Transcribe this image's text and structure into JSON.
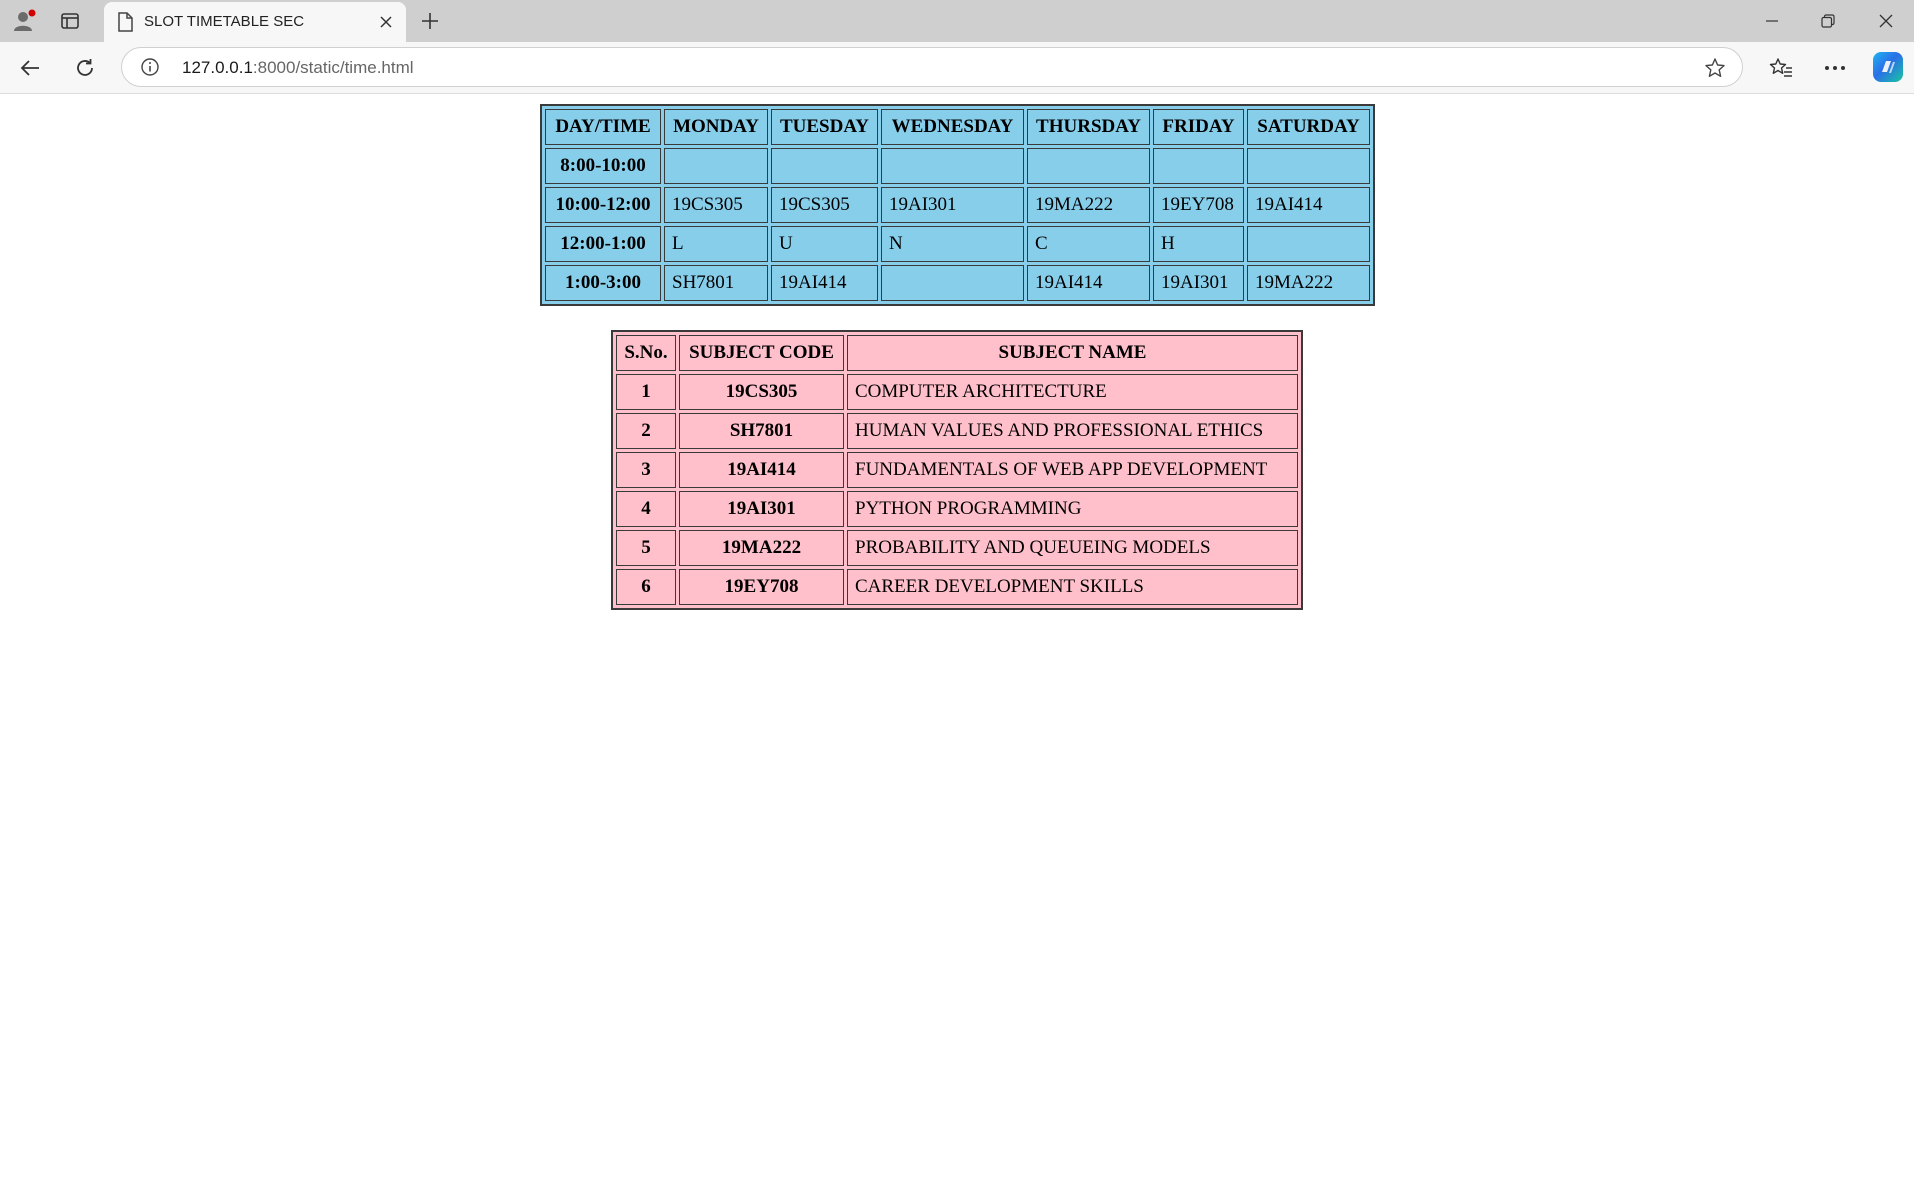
{
  "browser": {
    "tab_title": "SLOT TIMETABLE SEC",
    "url_host": "127.0.0.1",
    "url_path": ":8000/static/time.html"
  },
  "timetable": {
    "headers": [
      "DAY/TIME",
      "MONDAY",
      "TUESDAY",
      "WEDNESDAY",
      "THURSDAY",
      "FRIDAY",
      "SATURDAY"
    ],
    "rows": [
      {
        "time": "8:00-10:00",
        "cells": [
          "",
          "",
          "",
          "",
          "",
          ""
        ]
      },
      {
        "time": "10:00-12:00",
        "cells": [
          "19CS305",
          "19CS305",
          "19AI301",
          "19MA222",
          "19EY708",
          "19AI414"
        ]
      },
      {
        "time": "12:00-1:00",
        "cells": [
          "L",
          "U",
          "N",
          "C",
          "H",
          ""
        ]
      },
      {
        "time": "1:00-3:00",
        "cells": [
          "SH7801",
          "19AI414",
          "",
          "19AI414",
          "19AI301",
          "19MA222"
        ]
      }
    ],
    "background_color": "#87ceeb"
  },
  "subjects": {
    "headers": [
      "S.No.",
      "SUBJECT CODE",
      "SUBJECT NAME"
    ],
    "rows": [
      {
        "sno": "1",
        "code": "19CS305",
        "name": "COMPUTER ARCHITECTURE"
      },
      {
        "sno": "2",
        "code": "SH7801",
        "name": "HUMAN VALUES AND PROFESSIONAL ETHICS"
      },
      {
        "sno": "3",
        "code": "19AI414",
        "name": "FUNDAMENTALS OF WEB APP DEVELOPMENT"
      },
      {
        "sno": "4",
        "code": "19AI301",
        "name": "PYTHON PROGRAMMING"
      },
      {
        "sno": "5",
        "code": "19MA222",
        "name": "PROBABILITY AND QUEUEING MODELS"
      },
      {
        "sno": "6",
        "code": "19EY708",
        "name": "CAREER DEVELOPMENT SKILLS"
      }
    ],
    "background_color": "#ffc0cb"
  }
}
